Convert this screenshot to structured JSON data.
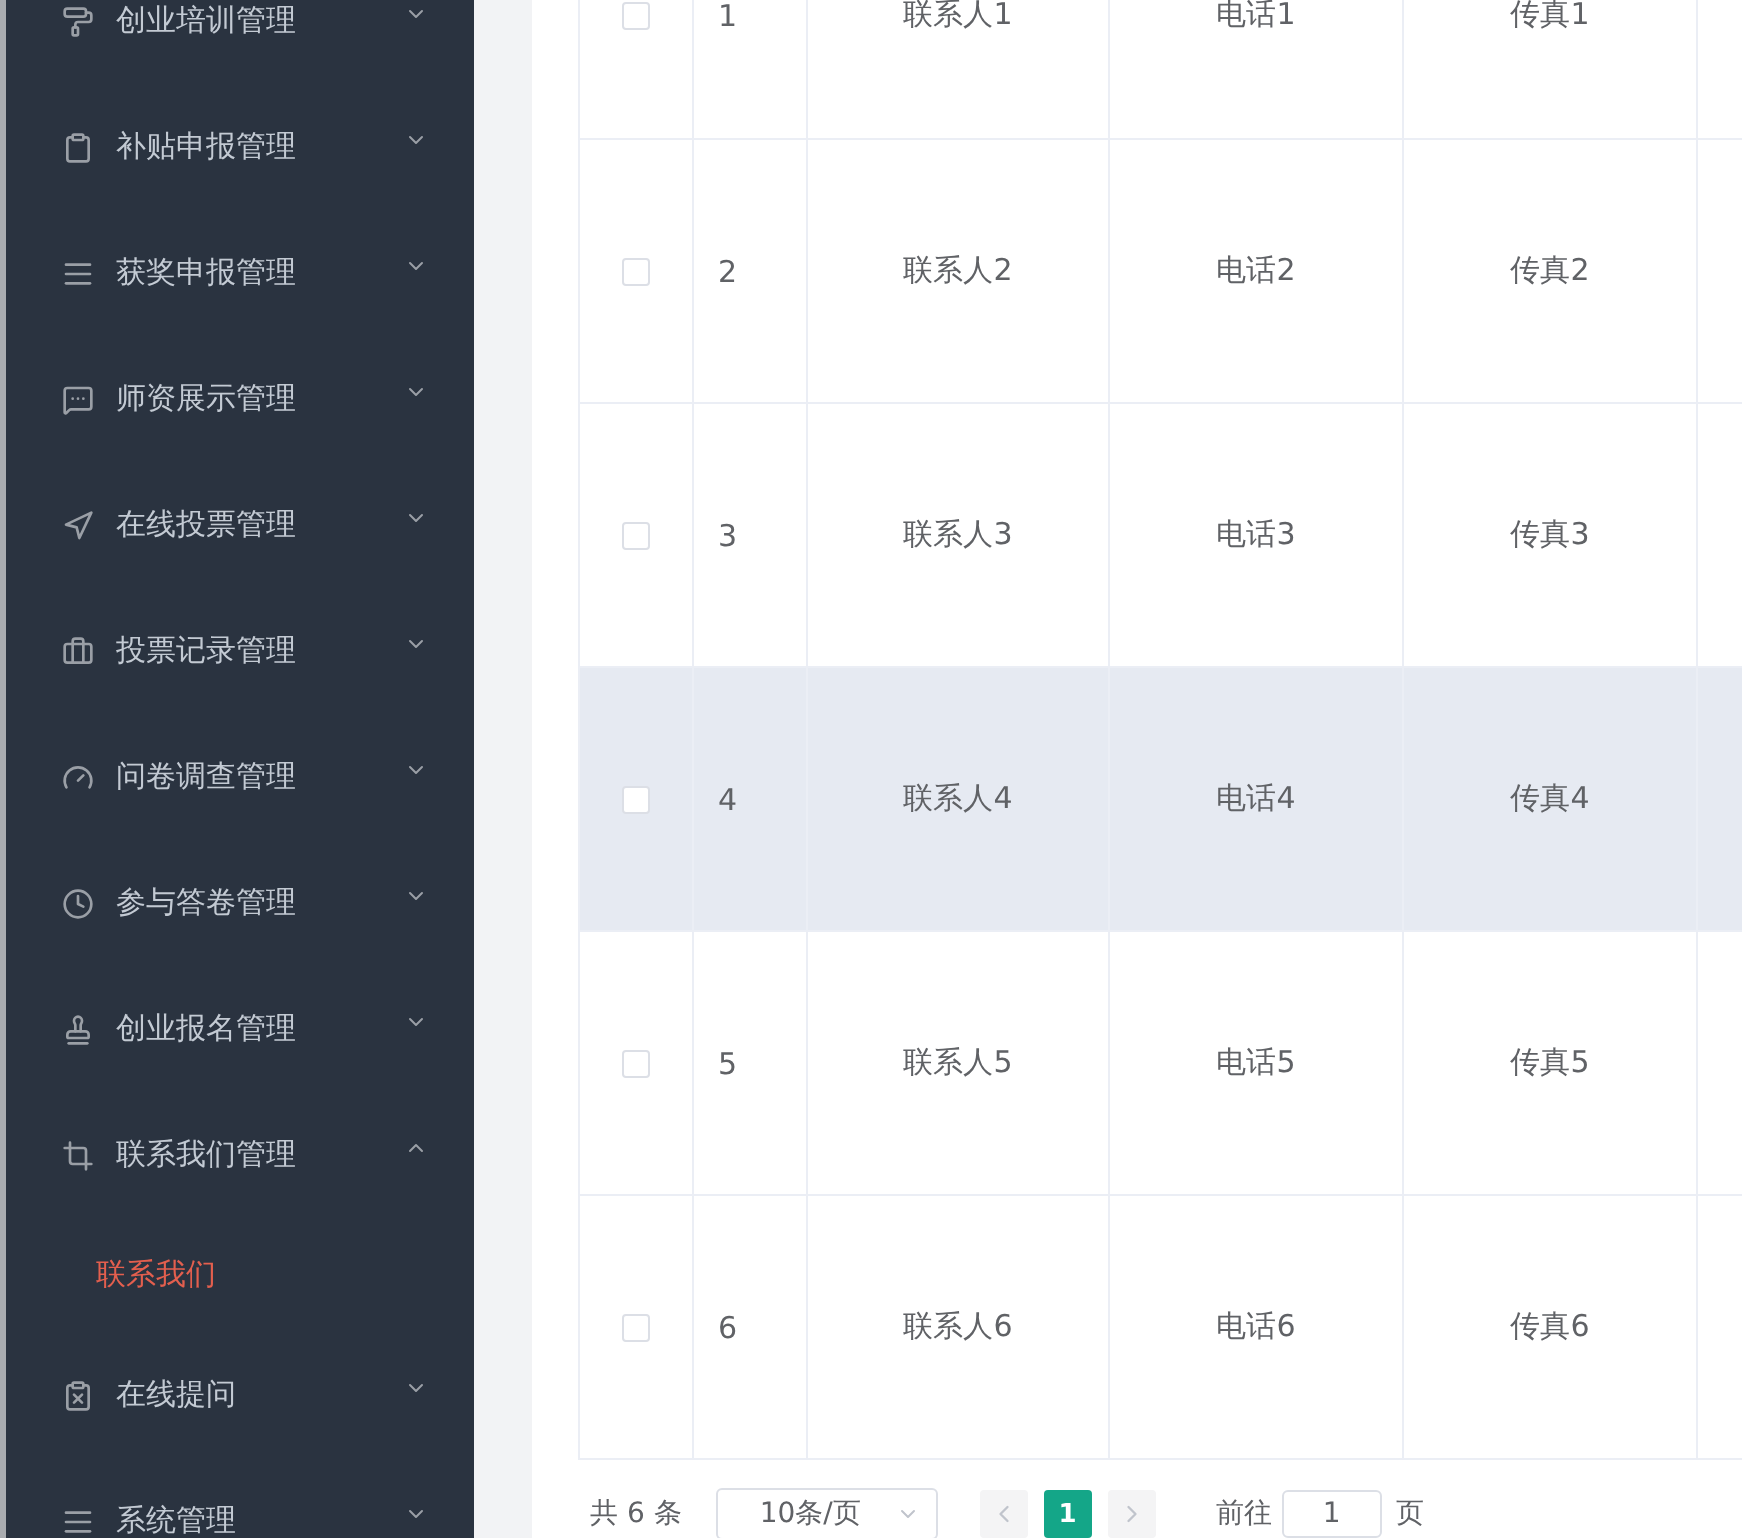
{
  "sidebar": {
    "items": [
      {
        "label": "创业培训管理",
        "expanded": false
      },
      {
        "label": "补贴申报管理",
        "expanded": false
      },
      {
        "label": "获奖申报管理",
        "expanded": false
      },
      {
        "label": "师资展示管理",
        "expanded": false
      },
      {
        "label": "在线投票管理",
        "expanded": false
      },
      {
        "label": "投票记录管理",
        "expanded": false
      },
      {
        "label": "问卷调查管理",
        "expanded": false
      },
      {
        "label": "参与答卷管理",
        "expanded": false
      },
      {
        "label": "创业报名管理",
        "expanded": false
      },
      {
        "label": "联系我们管理",
        "expanded": true,
        "children": [
          {
            "label": "联系我们",
            "selected": true
          }
        ]
      },
      {
        "label": "在线提问",
        "expanded": false
      },
      {
        "label": "系统管理",
        "expanded": false
      }
    ]
  },
  "table": {
    "rows": [
      {
        "checked": false,
        "highlighted": false,
        "cells": [
          "1",
          "联系人1",
          "电话1",
          "传真1"
        ]
      },
      {
        "checked": false,
        "highlighted": false,
        "cells": [
          "2",
          "联系人2",
          "电话2",
          "传真2"
        ]
      },
      {
        "checked": false,
        "highlighted": false,
        "cells": [
          "3",
          "联系人3",
          "电话3",
          "传真3"
        ]
      },
      {
        "checked": false,
        "highlighted": true,
        "cells": [
          "4",
          "联系人4",
          "电话4",
          "传真4"
        ]
      },
      {
        "checked": false,
        "highlighted": false,
        "cells": [
          "5",
          "联系人5",
          "电话5",
          "传真5"
        ]
      },
      {
        "checked": false,
        "highlighted": false,
        "cells": [
          "6",
          "联系人6",
          "电话6",
          "传真6"
        ]
      }
    ]
  },
  "pagination": {
    "total": "共 6 条",
    "page_size": "10条/页",
    "prev": {
      "disabled": true
    },
    "pages": [
      {
        "label": "1",
        "selected": true
      }
    ],
    "next": {
      "disabled": true
    },
    "goto": {
      "label": "前往",
      "value": "1",
      "suffix": "页"
    }
  }
}
